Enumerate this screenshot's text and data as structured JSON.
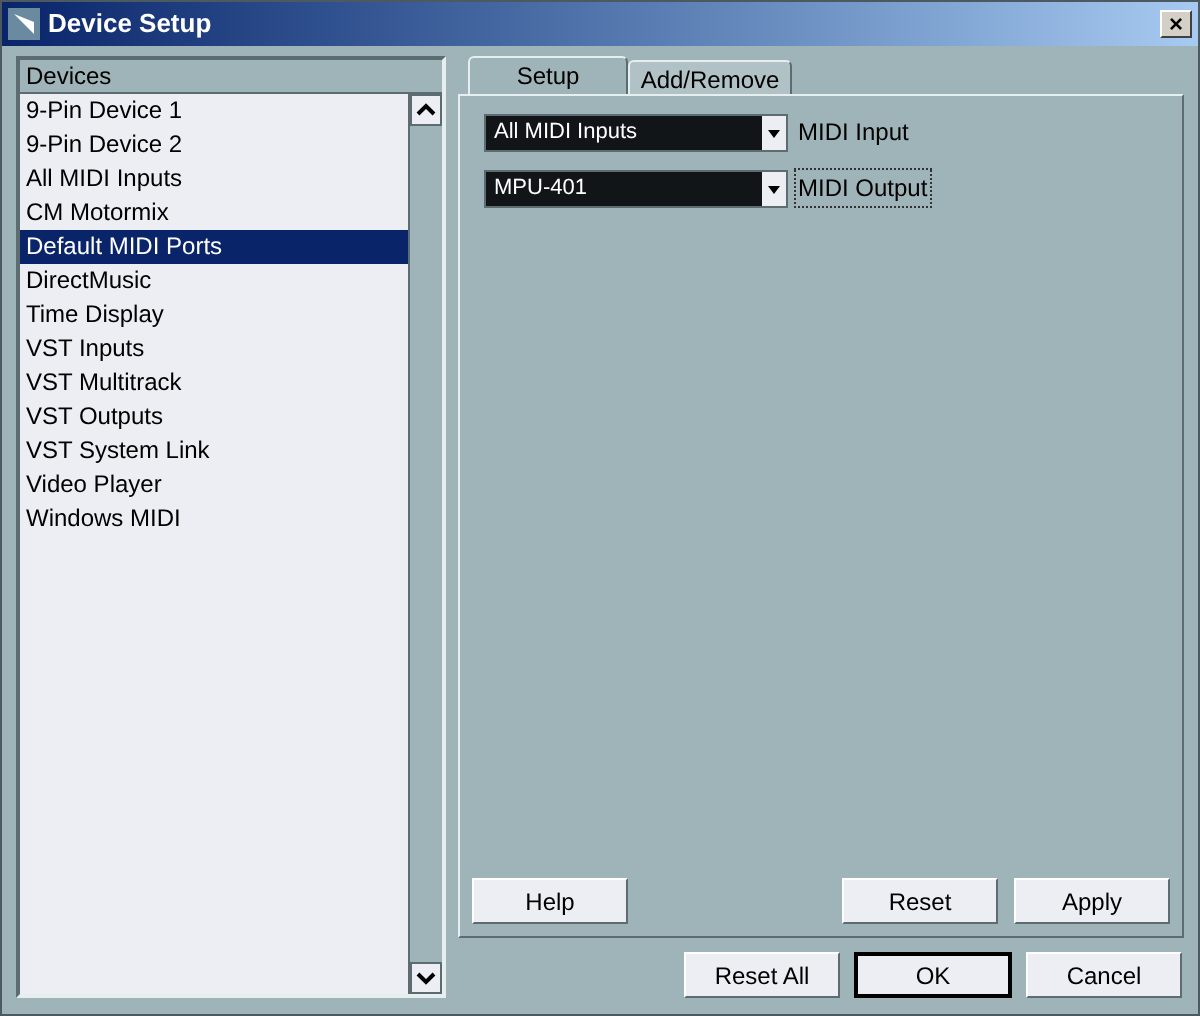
{
  "window": {
    "title": "Device Setup",
    "close": "×"
  },
  "devices": {
    "header": "Devices",
    "items": [
      {
        "label": "9-Pin Device 1",
        "selected": false
      },
      {
        "label": "9-Pin Device 2",
        "selected": false
      },
      {
        "label": "All MIDI Inputs",
        "selected": false
      },
      {
        "label": "CM Motormix",
        "selected": false
      },
      {
        "label": "Default MIDI Ports",
        "selected": true
      },
      {
        "label": "DirectMusic",
        "selected": false
      },
      {
        "label": "Time Display",
        "selected": false
      },
      {
        "label": "VST Inputs",
        "selected": false
      },
      {
        "label": "VST Multitrack",
        "selected": false
      },
      {
        "label": "VST Outputs",
        "selected": false
      },
      {
        "label": "VST System Link",
        "selected": false
      },
      {
        "label": "Video Player",
        "selected": false
      },
      {
        "label": "Windows MIDI",
        "selected": false
      }
    ]
  },
  "tabs": [
    {
      "label": "Setup",
      "selected": true
    },
    {
      "label": "Add/Remove",
      "selected": false
    }
  ],
  "settings": [
    {
      "value": "All MIDI Inputs",
      "label": "MIDI Input",
      "focused": false
    },
    {
      "value": "MPU-401",
      "label": "MIDI Output",
      "focused": true
    }
  ],
  "panel_buttons": [
    "Help",
    "Reset",
    "Apply"
  ],
  "dialog_buttons": [
    {
      "label": "Reset All",
      "default": false
    },
    {
      "label": "OK",
      "default": true
    },
    {
      "label": "Cancel",
      "default": false
    }
  ]
}
